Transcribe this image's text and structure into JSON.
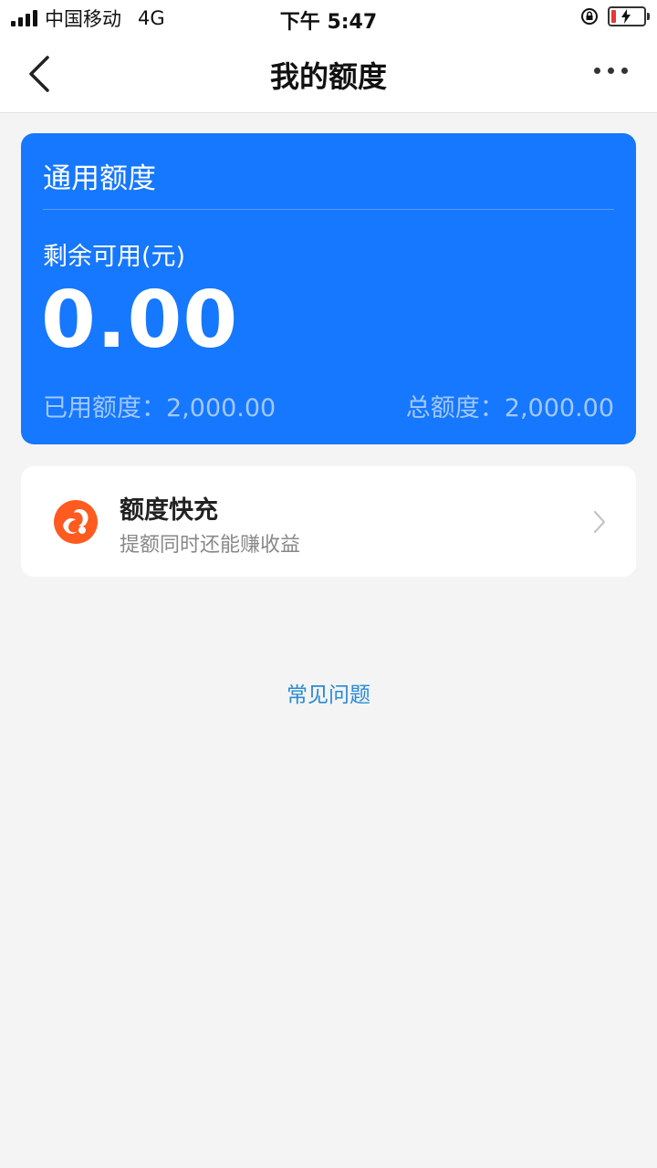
{
  "status_bar": {
    "carrier": "中国移动",
    "network": "4G",
    "time": "下午 5:47",
    "battery_color": "#e53935"
  },
  "nav": {
    "title": "我的额度",
    "back_icon": "chevron-left-icon",
    "more_icon": "more-dots-icon"
  },
  "quota_card": {
    "title": "通用额度",
    "remaining_label": "剩余可用(元)",
    "remaining_value": "0.00",
    "used_text": "已用额度：2,000.00",
    "total_text": "总额度：2,000.00",
    "background_color": "#1677ff"
  },
  "quick_charge": {
    "title": "额度快充",
    "subtitle": "提额同时还能赚收益",
    "icon": "quick-charge-logo-icon",
    "icon_color": "#ff5a1f"
  },
  "faq": {
    "label": "常见问题",
    "color": "#2a8ad6"
  }
}
